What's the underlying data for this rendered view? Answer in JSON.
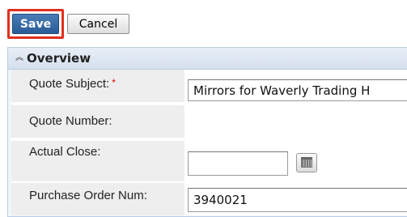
{
  "toolbar": {
    "save_label": "Save",
    "cancel_label": "Cancel"
  },
  "panel": {
    "title": "Overview",
    "collapse_icon": "double-chevron-up-icon"
  },
  "fields": {
    "quote_subject": {
      "label": "Quote Subject:",
      "required_marker": "*",
      "value": "Mirrors for Waverly Trading H"
    },
    "quote_number": {
      "label": "Quote Number:"
    },
    "actual_close": {
      "label": "Actual Close:",
      "value": "",
      "icon": "calendar-icon"
    },
    "purchase_order_num": {
      "label": "Purchase Order Num:",
      "value": "3940021"
    }
  },
  "colors": {
    "save_button": "#3a6ba8",
    "highlight": "#e0301e",
    "panel_header": "#dbe4f0",
    "label_background": "#eeeeee",
    "required": "#dd0000"
  }
}
